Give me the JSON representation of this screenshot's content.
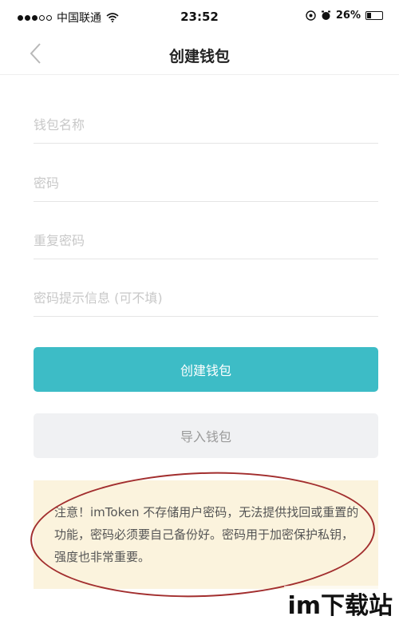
{
  "status_bar": {
    "carrier": "中国联通",
    "time": "23:52",
    "battery_percent": "26%",
    "battery_level": 0.26,
    "icons": [
      "signal-dots",
      "wifi-icon",
      "location-icon",
      "alarm-icon",
      "battery-icon"
    ]
  },
  "nav": {
    "title": "创建钱包",
    "back_icon": "chevron-left-icon"
  },
  "form": {
    "wallet_name_placeholder": "钱包名称",
    "password_placeholder": "密码",
    "repeat_password_placeholder": "重复密码",
    "hint_placeholder": "密码提示信息 (可不填)"
  },
  "buttons": {
    "create_label": "创建钱包",
    "import_label": "导入钱包"
  },
  "notice": {
    "text": "注意！imToken 不存储用户密码，无法提供找回或重置的功能，密码必须要自己备份好。密码用于加密保护私钥，强度也非常重要。"
  },
  "watermark": "im下载站",
  "colors": {
    "primary": "#3dbcc6",
    "secondary_bg": "#f0f1f3",
    "notice_bg": "#fbf3dd",
    "annotation": "#a22e2e"
  }
}
